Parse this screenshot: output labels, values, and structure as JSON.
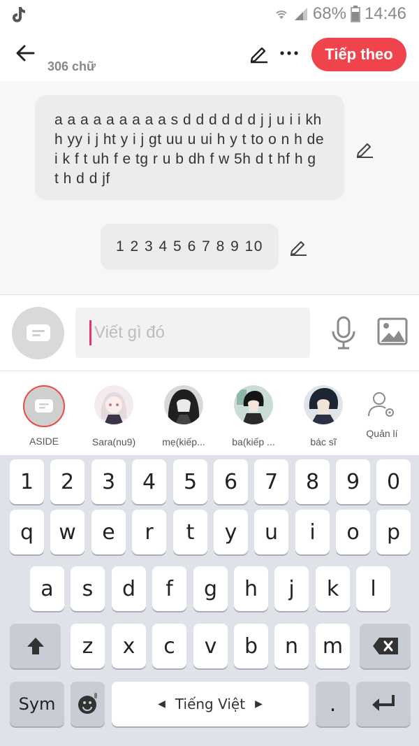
{
  "status": {
    "battery": "68%",
    "time": "14:46"
  },
  "header": {
    "char_count": "306 chữ",
    "next_label": "Tiếp theo"
  },
  "messages": [
    {
      "text": "a a a a a a a  a a  s d  d d d d d j j u i i kh h yy i j ht y i j gt uu u ui h y t to o n h de i k f t uh f e tg  r u b dh f w 5h d t hf h g t h d d jf"
    },
    {
      "text": "1 2 3 4 5 6 7 8 9 10"
    }
  ],
  "input": {
    "placeholder": "Viết gì đó"
  },
  "characters": [
    {
      "name": "ASIDE"
    },
    {
      "name": "Sara(nu9)"
    },
    {
      "name": "mẹ(kiếp..."
    },
    {
      "name": "ba(kiếp ..."
    },
    {
      "name": "bác sĩ"
    }
  ],
  "manage_label": "Quản lí",
  "keyboard": {
    "row1": [
      "1",
      "2",
      "3",
      "4",
      "5",
      "6",
      "7",
      "8",
      "9",
      "0"
    ],
    "row2": [
      "q",
      "w",
      "e",
      "r",
      "t",
      "y",
      "u",
      "i",
      "o",
      "p"
    ],
    "row3": [
      "a",
      "s",
      "d",
      "f",
      "g",
      "h",
      "j",
      "k",
      "l"
    ],
    "row4": [
      "z",
      "x",
      "c",
      "v",
      "b",
      "n",
      "m"
    ],
    "sym_label": "Sym",
    "space_label": "Tiếng Việt",
    "period": "."
  },
  "colors": {
    "accent": "#f0444c",
    "caret": "#e8336b"
  }
}
